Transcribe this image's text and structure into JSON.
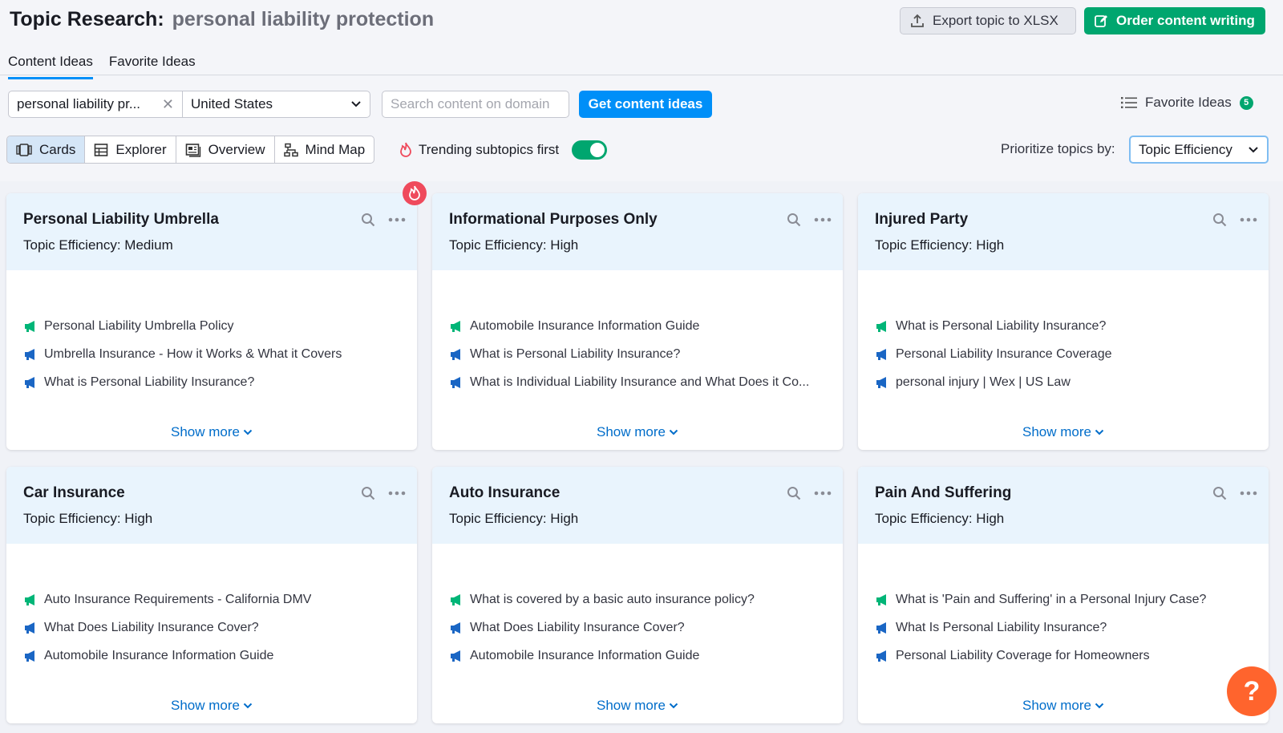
{
  "header": {
    "title": "Topic Research:",
    "subject": "personal liability protection",
    "export_label": "Export topic to XLSX",
    "order_label": "Order content writing"
  },
  "tabs": [
    {
      "label": "Content Ideas",
      "active": true
    },
    {
      "label": "Favorite Ideas",
      "active": false
    }
  ],
  "search": {
    "topic_value": "personal liability pr...",
    "country_value": "United States",
    "domain_placeholder": "Search content on domain",
    "get_ideas_label": "Get content ideas"
  },
  "favorites": {
    "label": "Favorite Ideas",
    "count": "5"
  },
  "views": [
    {
      "label": "Cards",
      "active": true,
      "icon": "cards-icon"
    },
    {
      "label": "Explorer",
      "active": false,
      "icon": "table-icon"
    },
    {
      "label": "Overview",
      "active": false,
      "icon": "overview-icon"
    },
    {
      "label": "Mind Map",
      "active": false,
      "icon": "mindmap-icon"
    }
  ],
  "trending": {
    "label": "Trending subtopics first",
    "enabled": true
  },
  "prioritize": {
    "label": "Prioritize topics by:",
    "value": "Topic Efficiency"
  },
  "colors": {
    "accent": "#008ff8",
    "green": "#00a66f",
    "megaphone_green": "#00b577",
    "megaphone_blue": "#1a66c4",
    "help": "#ff642d",
    "fire": "#ef4a5c"
  },
  "cards": [
    {
      "title": "Personal Liability Umbrella",
      "efficiency": "Topic Efficiency: Medium",
      "trending": true,
      "ideas": [
        {
          "text": "Personal Liability Umbrella Policy",
          "color": "green"
        },
        {
          "text": "Umbrella Insurance - How it Works & What it Covers",
          "color": "blue"
        },
        {
          "text": "What is Personal Liability Insurance?",
          "color": "blue"
        }
      ],
      "show_more": "Show more"
    },
    {
      "title": "Informational Purposes Only",
      "efficiency": "Topic Efficiency: High",
      "trending": false,
      "ideas": [
        {
          "text": "Automobile Insurance Information Guide",
          "color": "green"
        },
        {
          "text": "What is Personal Liability Insurance?",
          "color": "blue"
        },
        {
          "text": "What is Individual Liability Insurance and What Does it Co...",
          "color": "blue"
        }
      ],
      "show_more": "Show more"
    },
    {
      "title": "Injured Party",
      "efficiency": "Topic Efficiency: High",
      "trending": false,
      "ideas": [
        {
          "text": "What is Personal Liability Insurance?",
          "color": "green"
        },
        {
          "text": "Personal Liability Insurance Coverage",
          "color": "blue"
        },
        {
          "text": "personal injury | Wex | US Law",
          "color": "blue"
        }
      ],
      "show_more": "Show more"
    },
    {
      "title": "Car Insurance",
      "efficiency": "Topic Efficiency: High",
      "trending": false,
      "ideas": [
        {
          "text": "Auto Insurance Requirements - California DMV",
          "color": "green"
        },
        {
          "text": "What Does Liability Insurance Cover?",
          "color": "blue"
        },
        {
          "text": "Automobile Insurance Information Guide",
          "color": "blue"
        }
      ],
      "show_more": "Show more"
    },
    {
      "title": "Auto Insurance",
      "efficiency": "Topic Efficiency: High",
      "trending": false,
      "ideas": [
        {
          "text": "What is covered by a basic auto insurance policy?",
          "color": "green"
        },
        {
          "text": "What Does Liability Insurance Cover?",
          "color": "blue"
        },
        {
          "text": "Automobile Insurance Information Guide",
          "color": "blue"
        }
      ],
      "show_more": "Show more"
    },
    {
      "title": "Pain And Suffering",
      "efficiency": "Topic Efficiency: High",
      "trending": false,
      "ideas": [
        {
          "text": "What is 'Pain and Suffering' in a Personal Injury Case?",
          "color": "green"
        },
        {
          "text": "What Is Personal Liability Insurance?",
          "color": "blue"
        },
        {
          "text": "Personal Liability Coverage for Homeowners",
          "color": "blue"
        }
      ],
      "show_more": "Show more"
    }
  ],
  "help_label": "?"
}
